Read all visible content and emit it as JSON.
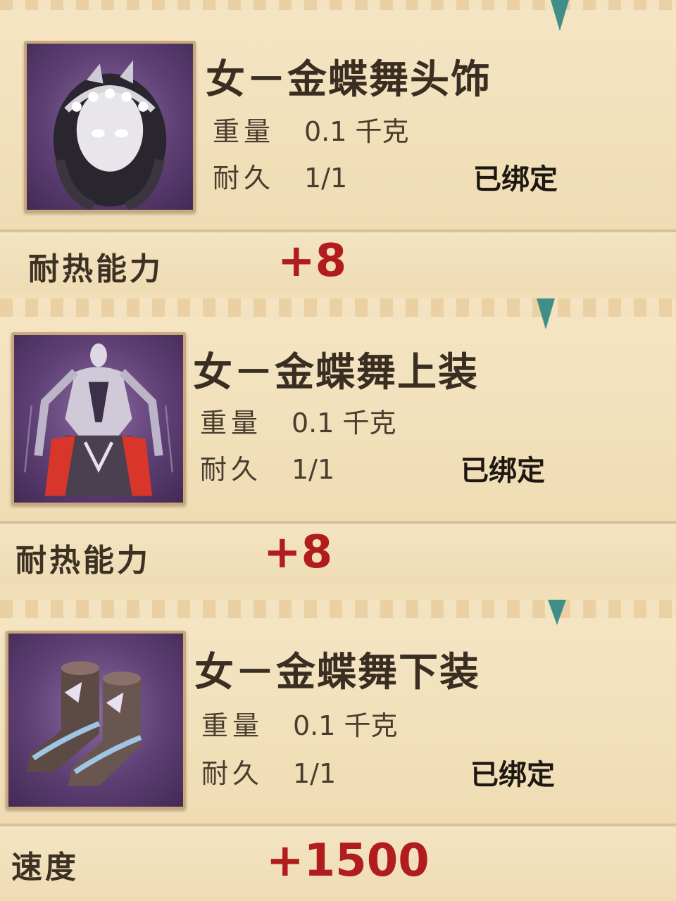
{
  "items": [
    {
      "name": "女－金蝶舞头饰",
      "weight_label": "重量",
      "weight_value": "0.1 千克",
      "durability_label": "耐久",
      "durability_value": "1/1",
      "bound_status": "已绑定",
      "stat_label": "耐热能力",
      "stat_value": "+8",
      "icon": "headdress-icon"
    },
    {
      "name": "女－金蝶舞上装",
      "weight_label": "重量",
      "weight_value": "0.1 千克",
      "durability_label": "耐久",
      "durability_value": "1/1",
      "bound_status": "已绑定",
      "stat_label": "耐热能力",
      "stat_value": "+8",
      "icon": "top-garment-icon"
    },
    {
      "name": "女－金蝶舞下装",
      "weight_label": "重量",
      "weight_value": "0.1 千克",
      "durability_label": "耐久",
      "durability_value": "1/1",
      "bound_status": "已绑定",
      "stat_label": "速度",
      "stat_value": "+1500",
      "icon": "boots-icon"
    }
  ],
  "colors": {
    "stat_value": "#b11d1d",
    "thumb_bg": "#5e3f74",
    "tab_marker": "#3f8f88",
    "panel_bg": "#f2e0ba"
  }
}
